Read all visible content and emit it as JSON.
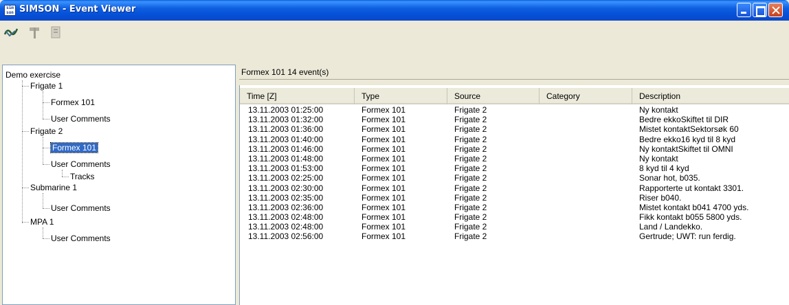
{
  "window": {
    "title": "SIMSON - Event Viewer",
    "icon": "simson-app-icon",
    "icon_text": "sim son"
  },
  "toolbar": {
    "buttons": [
      {
        "name": "wave-icon"
      },
      {
        "name": "signpost-icon"
      },
      {
        "name": "document-icon"
      }
    ]
  },
  "tree": {
    "root": "Demo exercise",
    "nodes": [
      {
        "label": "Frigate 1"
      },
      {
        "label": "Formex 101"
      },
      {
        "label": "User Comments"
      },
      {
        "label": "Frigate 2"
      },
      {
        "label": "Formex 101"
      },
      {
        "label": "User Comments"
      },
      {
        "label": "Tracks"
      },
      {
        "label": "Submarine 1"
      },
      {
        "label": "User Comments"
      },
      {
        "label": "MPA 1"
      },
      {
        "label": "User Comments"
      }
    ]
  },
  "events": {
    "header": "Formex 101  14 event(s)",
    "columns": [
      "Time [Z]",
      "Type",
      "Source",
      "Category",
      "Description"
    ],
    "rows": [
      {
        "time": "13.11.2003 01:25:00",
        "type": "Formex 101",
        "source": "Frigate 2",
        "category": "",
        "description": "Ny kontakt"
      },
      {
        "time": "13.11.2003 01:32:00",
        "type": "Formex 101",
        "source": "Frigate 2",
        "category": "",
        "description": "Bedre ekkoSkiftet til DIR"
      },
      {
        "time": "13.11.2003 01:36:00",
        "type": "Formex 101",
        "source": "Frigate 2",
        "category": "",
        "description": "Mistet kontaktSektorsøk 60"
      },
      {
        "time": "13.11.2003 01:40:00",
        "type": "Formex 101",
        "source": "Frigate 2",
        "category": "",
        "description": "Bedre ekko16 kyd til 8 kyd"
      },
      {
        "time": "13.11.2003 01:46:00",
        "type": "Formex 101",
        "source": "Frigate 2",
        "category": "",
        "description": "Ny kontaktSkiftet til OMNI"
      },
      {
        "time": "13.11.2003 01:48:00",
        "type": "Formex 101",
        "source": "Frigate 2",
        "category": "",
        "description": "Ny kontakt"
      },
      {
        "time": "13.11.2003 01:53:00",
        "type": "Formex 101",
        "source": "Frigate 2",
        "category": "",
        "description": "8 kyd til 4 kyd"
      },
      {
        "time": "13.11.2003 02:25:00",
        "type": "Formex 101",
        "source": "Frigate 2",
        "category": "",
        "description": "Sonar hot, b035."
      },
      {
        "time": "13.11.2003 02:30:00",
        "type": "Formex 101",
        "source": "Frigate 2",
        "category": "",
        "description": "Rapporterte ut kontakt 3301."
      },
      {
        "time": "13.11.2003 02:35:00",
        "type": "Formex 101",
        "source": "Frigate 2",
        "category": "",
        "description": "Riser b040."
      },
      {
        "time": "13.11.2003 02:36:00",
        "type": "Formex 101",
        "source": "Frigate 2",
        "category": "",
        "description": "Mistet kontakt b041 4700 yds."
      },
      {
        "time": "13.11.2003 02:48:00",
        "type": "Formex 101",
        "source": "Frigate 2",
        "category": "",
        "description": "Fikk kontakt b055 5800 yds."
      },
      {
        "time": "13.11.2003 02:48:00",
        "type": "Formex 101",
        "source": "Frigate 2",
        "category": "",
        "description": "Land / Landekko."
      },
      {
        "time": "13.11.2003 02:56:00",
        "type": "Formex 101",
        "source": "Frigate 2",
        "category": "",
        "description": "Gertrude; UWT: run ferdig."
      }
    ]
  },
  "colors": {
    "titlebar": "#0551d8",
    "selection": "#316ac5",
    "window_bg": "#ece9d8"
  }
}
